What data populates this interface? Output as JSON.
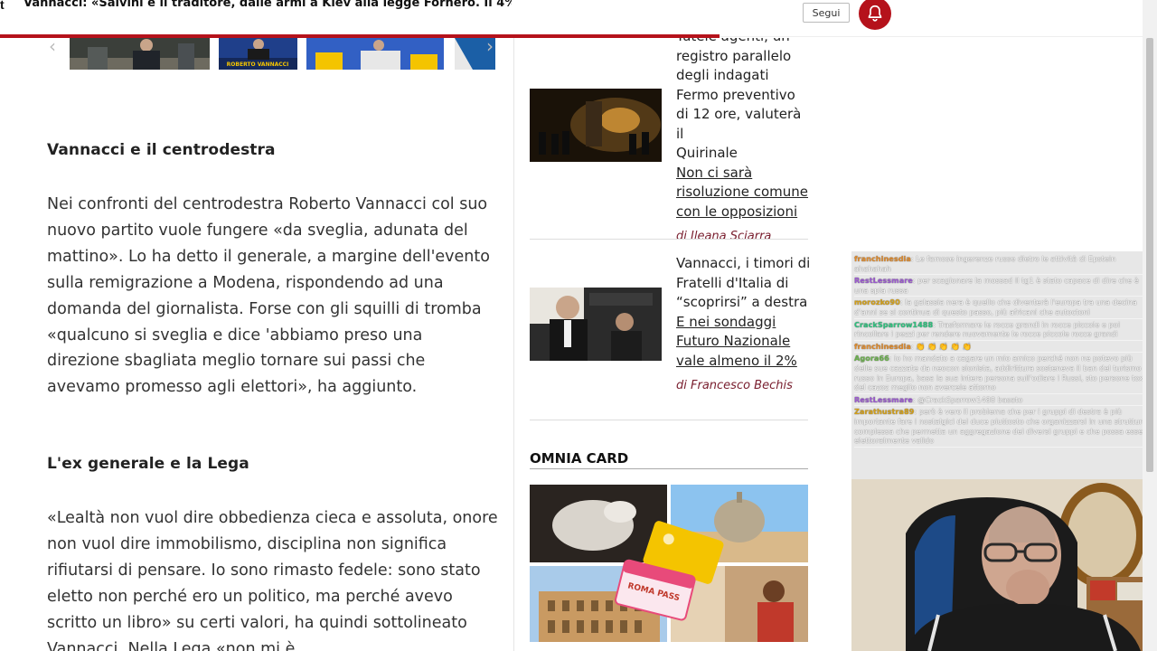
{
  "header": {
    "headline": "Vannacci: «Salvini è il traditore, dalle armi a Kiev alla legge Fornero. Il 4%...",
    "follow_label": "Segui",
    "left_mark": "t",
    "read_progress": 0.63
  },
  "article": {
    "heading_1": "Vannacci e il centrodestra",
    "paragraph_1": "Nei confronti del centrodestra Roberto Vannacci col suo nuovo partito vuole fungere «da sveglia, adunata del mattino». Lo ha detto il generale, a margine dell'evento sulla remigrazione a Modena, rispondendo ad una domanda del giornalista. Forse con gli squilli di tromba «qualcuno si sveglia e dice 'abbiamo preso una direzione sbagliata meglio tornare sui passi che avevamo promesso agli elettori», ha aggiunto.",
    "heading_2": "L'ex generale e la Lega",
    "paragraph_2": "«Lealtà non vuol dire obbedienza cieca e assoluta, onore non vuol dire immobilismo, disciplina non significa rifiutarsi di pensare. Io sono rimasto fedele: sono stato eletto non perché ero un politico, ma perché avevo scritto un libro» su certi valori, ha quindi sottolineato Vannacci. Nella Lega «non mi è"
  },
  "gallery": {
    "caption": "ROBERTO VANNACCI"
  },
  "sidebar": {
    "card_1": {
      "title_lines": [
        "Tutele agenti, un",
        "registro parallelo",
        "degli indagati",
        "Fermo preventivo",
        "di 12 ore, valuterà il",
        "Quirinale"
      ],
      "sub_lines": [
        "Non ci sarà",
        "risoluzione comune",
        "con le opposizioni"
      ],
      "author": "di Ileana Sciarra"
    },
    "card_2": {
      "title_lines": [
        "Vannacci, i timori di",
        "Fratelli d'Italia di",
        "“scoprirsi” a destra"
      ],
      "sub_lines": [
        "E nei sondaggi",
        "Futuro Nazionale",
        "vale almeno il 2%"
      ],
      "author": "di Francesco Bechis"
    },
    "omnia_title": "OMNIA CARD",
    "omnia_card_text": "ROMA PASS"
  },
  "chat": {
    "messages": [
      {
        "user": "franchinesdia",
        "color": "#e08a2a",
        "text": ": Le famose ingerenze russe dietro le attività di Epstein ahahahah"
      },
      {
        "user": "RestLessmare",
        "color": "#9b59d0",
        "text": ": per scagionare la mossad il tg1 è stato capace di dire che è una spia russa"
      },
      {
        "user": "morozko90",
        "color": "#d4a017",
        "text": ": la galassia nera è quello che diventerà l'europa tra una decina d'anni se si continua di questo passo, più africani che autoctoni"
      },
      {
        "user": "CrackSparrow1488",
        "color": "#2ec27e",
        "text": ": Trasformare le rocce grandi in rocce piccole e poi rincollare i pezzi per rendere nuovamente le rocce piccole rocce grandi"
      },
      {
        "user": "franchinesdia",
        "color": "#e08a2a",
        "text": ": 👏 👏 👏 👏 👏"
      },
      {
        "user": "Agora66",
        "color": "#6ab04c",
        "text": ": io ho mandato a cagare un mio amico perché non ne potevo più delle sue cazzate da neocon sionista, addirittura sosteneva il ban del turismo russo in Europa, basa la sua intera persona sull'odiare i Russi, sto persone toxic del cazoz meglio non avercele attorno"
      },
      {
        "user": "RestLessmare",
        "color": "#9b59d0",
        "text": ": @CrackSparrow1488 basato"
      },
      {
        "user": "Zarathustra89",
        "color": "#d4a017",
        "text": ": però è vero il problema che per i gruppi di destra è più importante fare i nostalgici del duce piuttosto che organizzarsi in una struttura complessa che permetta un aggregazione dei diversi gruppi e che possa essere elettoralmente valido"
      }
    ]
  },
  "colors": {
    "brand_red": "#b5121b",
    "author_color": "#7a2030"
  }
}
